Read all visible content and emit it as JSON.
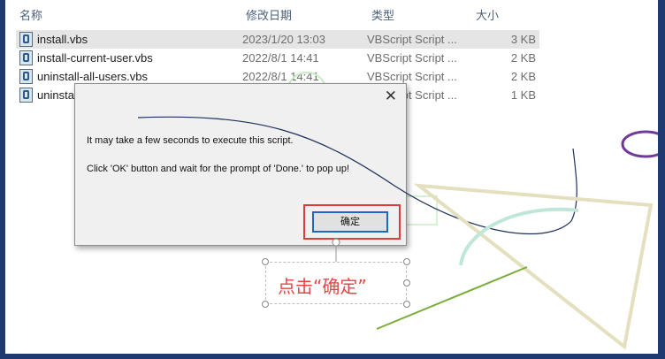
{
  "explorer": {
    "columns": {
      "name": "名称",
      "date": "修改日期",
      "type": "类型",
      "size": "大小"
    },
    "files": [
      {
        "name": "install.vbs",
        "date": "2023/1/20 13:03",
        "type": "VBScript Script ...",
        "size": "3 KB"
      },
      {
        "name": "install-current-user.vbs",
        "date": "2022/8/1 14:41",
        "type": "VBScript Script ...",
        "size": "2 KB"
      },
      {
        "name": "uninstall-all-users.vbs",
        "date": "2022/8/1 14:41",
        "type": "VBScript Script ...",
        "size": "2 KB"
      },
      {
        "name": "uninstal",
        "date": "",
        "type": "VBScript Script ...",
        "size": "1 KB"
      }
    ]
  },
  "dialog": {
    "close_glyph": "✕",
    "message_line1": "It may take a few seconds to execute this script.",
    "message_line2": "Click 'OK' button and wait for the prompt of 'Done.' to pop up!",
    "ok_label": "确定"
  },
  "annotation": {
    "text": "点击“确定”"
  },
  "colors": {
    "highlight_red": "#e23a3a",
    "annotation_red": "#e64545",
    "frame_blue": "#1f3a6e"
  }
}
